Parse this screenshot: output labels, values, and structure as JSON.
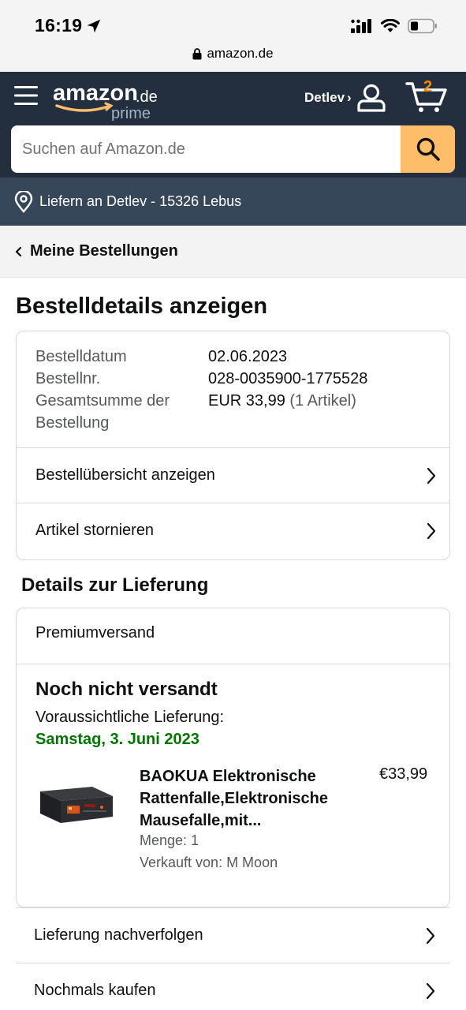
{
  "status_bar": {
    "time": "16:19"
  },
  "browser": {
    "url": "amazon.de"
  },
  "header": {
    "logo_main": "amazon",
    "logo_tld": ".de",
    "logo_prime": "prime",
    "account_name": "Detlev",
    "account_chevron": "›",
    "cart_count": "2",
    "accent_color": "#febd69",
    "nav_bg": "#232f3e"
  },
  "search": {
    "placeholder": "Suchen auf Amazon.de"
  },
  "delivery_location": {
    "text": "Liefern an Detlev - 15326 Lebus"
  },
  "breadcrumb": {
    "label": "Meine Bestellungen"
  },
  "page": {
    "title": "Bestelldetails anzeigen"
  },
  "order": {
    "date_label": "Bestelldatum",
    "date_value": "02.06.2023",
    "number_label": "Bestellnr.",
    "number_value": "028-0035900-1775528",
    "total_label": "Gesamtsumme der Bestellung",
    "total_value": "EUR 33,99",
    "total_items": "(1 Artikel)",
    "links": [
      {
        "label": "Bestellübersicht anzeigen"
      },
      {
        "label": "Artikel stornieren"
      }
    ]
  },
  "delivery": {
    "section_title": "Details zur Lieferung",
    "shipping_method": "Premiumversand",
    "status": "Noch nicht versandt",
    "eta_label": "Voraussichtliche Lieferung:",
    "eta_date": "Samstag, 3. Juni 2023",
    "eta_color": "#007600",
    "item": {
      "title": "BAOKUA Elektronische Rattenfalle,Elektronische Mausefalle,mit...",
      "price": "€33,99",
      "quantity": "Menge: 1",
      "seller": "Verkauft von: M Moon"
    }
  },
  "actions": [
    {
      "label": "Lieferung nachverfolgen"
    },
    {
      "label": "Nochmals kaufen"
    }
  ]
}
